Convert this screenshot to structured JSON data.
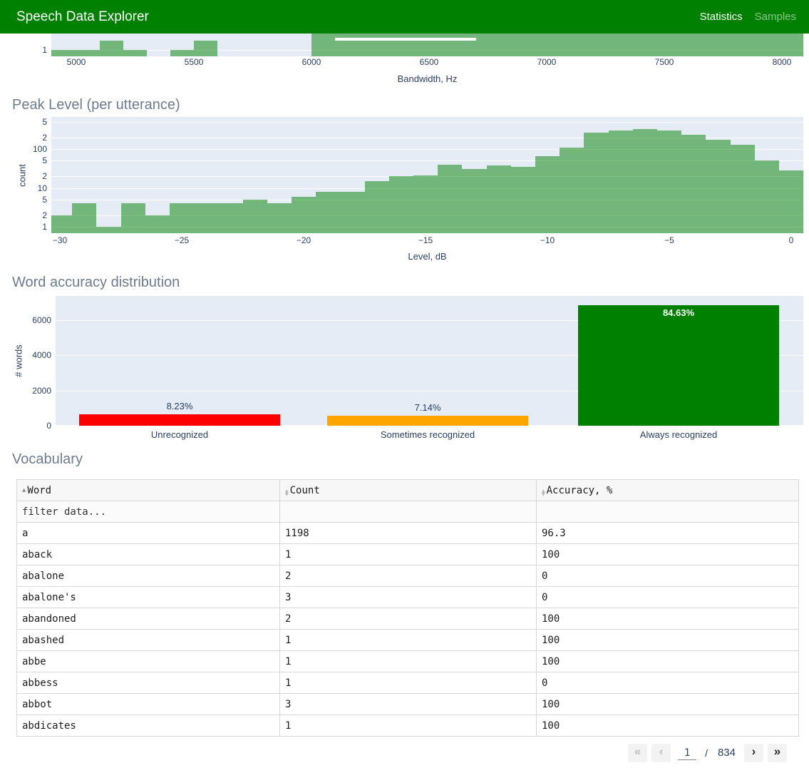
{
  "header": {
    "title": "Speech Data Explorer",
    "nav_statistics": "Statistics",
    "nav_samples": "Samples"
  },
  "colors": {
    "header_bg": "#008000",
    "header_text": "#ffffff",
    "nav_inactive": "rgba(255,255,255,0.55)",
    "plot_bg": "#e5ecf6",
    "hist_bar": "rgba(0,128,0,0.5)",
    "grid_line": "#ffffff",
    "tick_text": "#2a3f5f",
    "section_title": "#6e7b8d",
    "accuracy_red": "#ff0000",
    "accuracy_orange": "#ffa500",
    "accuracy_green": "#008000",
    "table_border": "#d6d6d6"
  },
  "chart_data": [
    {
      "id": "bandwidth",
      "type": "histogram",
      "xlabel": "Bandwidth, Hz",
      "ylabel": "",
      "yscale": "log",
      "clipped_by_scroll": true,
      "x_ticks": [
        5000,
        5500,
        6000,
        6500,
        7000,
        7500,
        8000
      ],
      "y_tick_label": "1",
      "bars": [
        {
          "x1": 4894,
          "x2": 5300,
          "count": 1
        },
        {
          "x1": 5100,
          "x2": 5200,
          "count": 2
        },
        {
          "x1": 5400,
          "x2": 5600,
          "count": 1
        },
        {
          "x1": 5500,
          "x2": 5600,
          "count": 2
        },
        {
          "x1": 6000,
          "x2": 8095,
          "count": "offscale-top-clipped"
        },
        {
          "x1": 6100,
          "x2": 6700,
          "count": "offscale-slightly-lower"
        }
      ]
    },
    {
      "id": "peak_level",
      "type": "histogram",
      "title": "Peak Level (per utterance)",
      "xlabel": "Level, dB",
      "ylabel": "count",
      "yscale": "log",
      "x_ticks": [
        -30,
        -25,
        -20,
        -15,
        -10,
        -5,
        0
      ],
      "y_ticks": [
        {
          "label": "1",
          "value": 1
        },
        {
          "label": "2",
          "value": 2
        },
        {
          "label": "5",
          "value": 5
        },
        {
          "label": "10",
          "value": 10
        },
        {
          "label": "2",
          "value": 20
        },
        {
          "label": "5",
          "value": 50
        },
        {
          "label": "100",
          "value": 100
        },
        {
          "label": "2",
          "value": 200
        },
        {
          "label": "5",
          "value": 500
        }
      ],
      "bin_centers_db": [
        -30,
        -29,
        -28,
        -27,
        -26,
        -25,
        -24,
        -23,
        -22,
        -21,
        -20,
        -19,
        -18,
        -17,
        -16,
        -15,
        -14,
        -13,
        -12,
        -11,
        -10,
        -9,
        -8,
        -7,
        -6,
        -5,
        -4,
        -3,
        -2,
        -1,
        0
      ],
      "counts": [
        2,
        4,
        1,
        4,
        2,
        4,
        4,
        4,
        5,
        4,
        6,
        8,
        8,
        15,
        20,
        21,
        40,
        30,
        38,
        35,
        65,
        110,
        260,
        295,
        325,
        295,
        230,
        175,
        128,
        51,
        28
      ]
    },
    {
      "id": "word_accuracy",
      "type": "bar",
      "title": "Word accuracy distribution",
      "xlabel": "",
      "ylabel": "# words",
      "categories": [
        "Unrecognized",
        "Sometimes recognized",
        "Always recognized"
      ],
      "values": [
        666,
        578,
        6851
      ],
      "percent_labels": [
        "8.23%",
        "7.14%",
        "84.63%"
      ],
      "bar_colors": [
        "#ff0000",
        "#ffa500",
        "#008000"
      ],
      "label_inside": [
        false,
        false,
        true
      ],
      "y_ticks": [
        0,
        2000,
        4000,
        6000
      ],
      "ylim": [
        0,
        7380
      ],
      "grid": true,
      "legend": "none"
    }
  ],
  "vocabulary": {
    "title": "Vocabulary",
    "filter_placeholder": "filter data...",
    "columns": [
      {
        "label": "Word",
        "sort_icon": "asc"
      },
      {
        "label": "Count",
        "sort_icon": "updown"
      },
      {
        "label": "Accuracy, %",
        "sort_icon": "updown"
      }
    ],
    "rows": [
      [
        "a",
        "1198",
        "96.3"
      ],
      [
        "aback",
        "1",
        "100"
      ],
      [
        "abalone",
        "2",
        "0"
      ],
      [
        "abalone's",
        "3",
        "0"
      ],
      [
        "abandoned",
        "2",
        "100"
      ],
      [
        "abashed",
        "1",
        "100"
      ],
      [
        "abbe",
        "1",
        "100"
      ],
      [
        "abbess",
        "1",
        "0"
      ],
      [
        "abbot",
        "3",
        "100"
      ],
      [
        "abdicates",
        "1",
        "100"
      ]
    ]
  },
  "pagination": {
    "first_label": "«",
    "prev_label": "‹",
    "next_label": "›",
    "last_label": "»",
    "first_enabled": false,
    "prev_enabled": false,
    "next_enabled": true,
    "last_enabled": true,
    "current_page": "1",
    "separator": "/",
    "total_pages": "834"
  }
}
